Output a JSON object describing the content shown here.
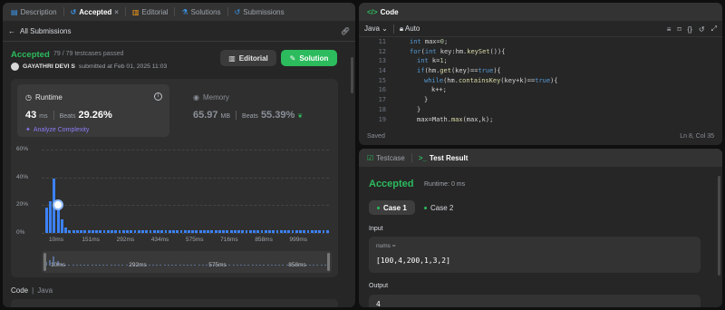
{
  "left_tabs": [
    {
      "label": "Description",
      "icon": "description-icon"
    },
    {
      "label": "Accepted",
      "icon": "history-icon",
      "close": "×"
    },
    {
      "label": "Editorial",
      "icon": "book-icon"
    },
    {
      "label": "Solutions",
      "icon": "flask-icon"
    },
    {
      "label": "Submissions",
      "icon": "history-icon"
    }
  ],
  "nav": {
    "back_label": "All Submissions"
  },
  "submission": {
    "status": "Accepted",
    "testcases": "79 / 79 testcases passed",
    "user": "GAYATHRI DEVI S",
    "submitted_at": "submitted at Feb 01, 2025 11:03",
    "editorial_button": "Editorial",
    "solution_button": "Solution"
  },
  "runtime": {
    "label": "Runtime",
    "value": "43",
    "unit": "ms",
    "beats_label": "Beats",
    "beats_pct": "29.26%",
    "analyze": "Analyze Complexity"
  },
  "memory": {
    "label": "Memory",
    "value": "65.97",
    "unit": "MB",
    "beats_label": "Beats",
    "beats_pct": "55.39%"
  },
  "chart_data": {
    "type": "bar",
    "y_ticks": [
      "60%",
      "40%",
      "20%",
      "0%"
    ],
    "ylim": [
      0,
      60
    ],
    "x_ticks": [
      "10ms",
      "151ms",
      "292ms",
      "434ms",
      "575ms",
      "716ms",
      "858ms",
      "999ms"
    ],
    "values": [
      18,
      23,
      39,
      20,
      10,
      4,
      2,
      2,
      2,
      2,
      2,
      2,
      2,
      2,
      2,
      2,
      2,
      2,
      2,
      2,
      2,
      2,
      2,
      2,
      2,
      2,
      2,
      2,
      2,
      2,
      2,
      2,
      2,
      2,
      2,
      2,
      2,
      2,
      2,
      2,
      2,
      2,
      2,
      2,
      2,
      2,
      2,
      2,
      2,
      2,
      2,
      2,
      2,
      2,
      2,
      2,
      2,
      2,
      2,
      2,
      2,
      2,
      2,
      2,
      2,
      2,
      2,
      2,
      2,
      2,
      2,
      2,
      2,
      2
    ],
    "highlight_index": 3,
    "range_labels": [
      "10ms",
      "292ms",
      "575ms",
      "858ms"
    ]
  },
  "code_section": {
    "label": "Code",
    "language": "Java"
  },
  "editor": {
    "title": "Code",
    "language": "Java",
    "mode": "Auto",
    "status": "Saved",
    "cursor": "Ln 8, Col 35",
    "lines": [
      {
        "n": "11",
        "t": "int max=0;",
        "indent": 4
      },
      {
        "n": "12",
        "t": "for(int key:hm.keySet()){",
        "indent": 4
      },
      {
        "n": "13",
        "t": "int k=1;",
        "indent": 6
      },
      {
        "n": "14",
        "t": "if(hm.get(key)==true){",
        "indent": 6
      },
      {
        "n": "15",
        "t": "while(hm.containsKey(key+k)==true){",
        "indent": 8
      },
      {
        "n": "16",
        "t": "k++;",
        "indent": 10
      },
      {
        "n": "17",
        "t": "}",
        "indent": 8
      },
      {
        "n": "18",
        "t": "}",
        "indent": 6
      },
      {
        "n": "19",
        "t": "max=Math.max(max,k);",
        "indent": 6
      }
    ]
  },
  "result": {
    "tab_testcase": "Testcase",
    "tab_result": "Test Result",
    "status": "Accepted",
    "runtime": "Runtime: 0 ms",
    "cases": [
      "Case 1",
      "Case 2"
    ],
    "input_label": "Input",
    "param_name": "nums =",
    "param_value": "[100,4,200,1,3,2]",
    "output_label": "Output",
    "output_value": "4"
  },
  "colors": {
    "accepted": "#2cbb5d",
    "bar": "#3b82f6",
    "accent_orange": "#ffa116"
  }
}
